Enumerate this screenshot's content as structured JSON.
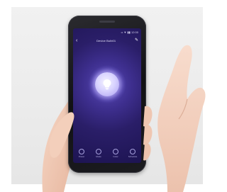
{
  "scene": {
    "description_kind": "product photo",
    "background_color": "#ececec"
  },
  "phone": {
    "status_bar": {
      "text": "•• ▼ ▮▮ 12:00"
    },
    "app_bar": {
      "title": "Device Bulb01",
      "back_icon": "back-arrow-icon",
      "edit_icon": "edit-pencil-icon"
    },
    "power_button": {
      "icon": "lightbulb-icon",
      "accent_color": "#d9d4ff"
    },
    "bottom_nav": {
      "items": [
        {
          "label": "Power",
          "icon": "power-icon"
        },
        {
          "label": "Mode",
          "icon": "mode-icon"
        },
        {
          "label": "Color",
          "icon": "color-icon"
        },
        {
          "label": "Schedule",
          "icon": "clock-icon"
        }
      ]
    },
    "screen_color": "#2a1e68"
  }
}
